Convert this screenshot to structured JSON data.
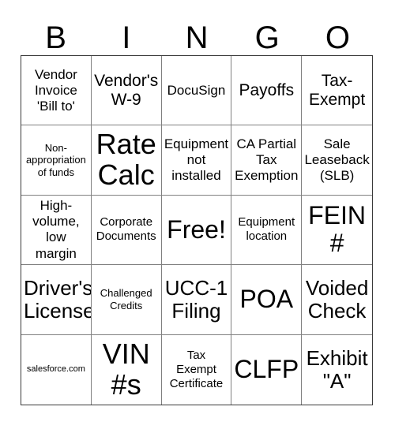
{
  "header": {
    "letters": [
      "B",
      "I",
      "N",
      "G",
      "O"
    ]
  },
  "grid": {
    "rows": 5,
    "columns": 5,
    "border_color": "#3a3a3a",
    "line_color": "#808080",
    "cell_background": "#ffffff",
    "text_color": "#000000"
  },
  "cells": [
    {
      "text": "Vendor\nInvoice\n'Bill to'",
      "size": "m"
    },
    {
      "text": "Vendor's\nW-9",
      "size": "l"
    },
    {
      "text": "DocuSign",
      "size": "m"
    },
    {
      "text": "Payoffs",
      "size": "l"
    },
    {
      "text": "Tax-\nExempt",
      "size": "l"
    },
    {
      "text": "Non-\nappropriation\nof funds",
      "size": "xs"
    },
    {
      "text": "Rate\nCalc",
      "size": "huge"
    },
    {
      "text": "Equipment\nnot\ninstalled",
      "size": "m"
    },
    {
      "text": "CA Partial\nTax\nExemption",
      "size": "m"
    },
    {
      "text": "Sale\nLeaseback\n(SLB)",
      "size": "m"
    },
    {
      "text": "High-\nvolume,\nlow\nmargin",
      "size": "m"
    },
    {
      "text": "Corporate\nDocuments",
      "size": "s"
    },
    {
      "text": "Free!",
      "size": "xxl"
    },
    {
      "text": "Equipment\nlocation",
      "size": "s"
    },
    {
      "text": "FEIN\n#",
      "size": "xxl"
    },
    {
      "text": "Driver's\nLicense",
      "size": "xl"
    },
    {
      "text": "Challenged\nCredits",
      "size": "xs"
    },
    {
      "text": "UCC-1\nFiling",
      "size": "xl"
    },
    {
      "text": "POA",
      "size": "xxl"
    },
    {
      "text": "Voided\nCheck",
      "size": "xl"
    },
    {
      "text": "salesforce.com",
      "size": "xxs"
    },
    {
      "text": "VIN\n#s",
      "size": "huge"
    },
    {
      "text": "Tax\nExempt\nCertificate",
      "size": "s"
    },
    {
      "text": "CLFP",
      "size": "xxl"
    },
    {
      "text": "Exhibit\n\"A\"",
      "size": "xl"
    }
  ]
}
